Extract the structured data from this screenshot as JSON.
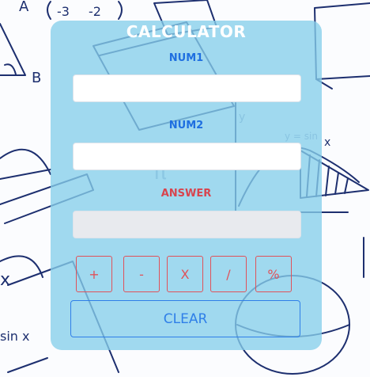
{
  "calculator": {
    "title": "CALCULATOR",
    "num1_label": "NUM1",
    "num1_value": "",
    "num2_label": "NUM2",
    "num2_value": "",
    "answer_label": "ANSWER",
    "answer_value": "",
    "operators": {
      "add": "+",
      "subtract": "-",
      "multiply": "X",
      "divide": "/",
      "percent": "%"
    },
    "clear_label": "CLEAR"
  },
  "colors": {
    "card": "#87ceeb",
    "label_blue": "#1f6fe0",
    "label_red": "#d8444e",
    "operator_border": "#e0525a",
    "clear_border": "#2f7fe8"
  }
}
